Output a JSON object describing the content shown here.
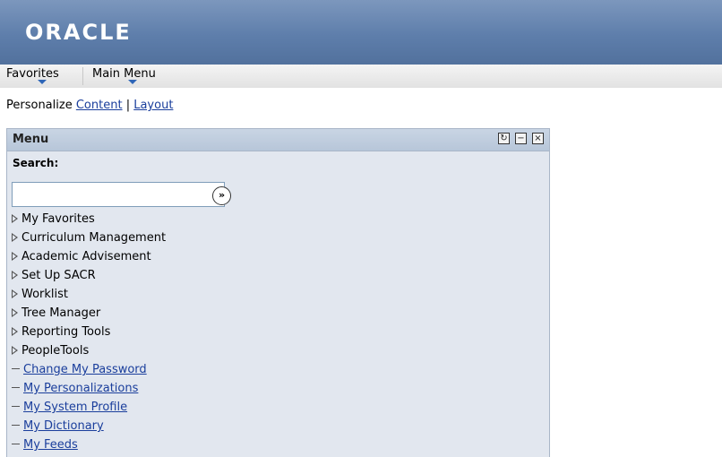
{
  "banner": {
    "logo": "ORACLE",
    "logo_mark": "®"
  },
  "nav": {
    "favorites": "Favorites",
    "main_menu": "Main Menu"
  },
  "personalize": {
    "label": "Personalize",
    "content": "Content",
    "separator": "|",
    "layout": "Layout"
  },
  "pagelet": {
    "title": "Menu",
    "refresh_icon": "refresh-icon",
    "minimize_icon": "minimize-icon",
    "close_icon": "close-icon",
    "search_label": "Search:",
    "search_value": "",
    "folders": [
      "My Favorites",
      "Curriculum Management",
      "Academic Advisement",
      "Set Up SACR",
      "Worklist",
      "Tree Manager",
      "Reporting Tools",
      "PeopleTools"
    ],
    "links": [
      "Change My Password",
      "My Personalizations",
      "My System Profile",
      "My Dictionary",
      "My Feeds"
    ]
  },
  "colors": {
    "banner": "#5e7eab",
    "link": "#1a3e9c",
    "pagelet_bg": "#e2e7ef"
  }
}
